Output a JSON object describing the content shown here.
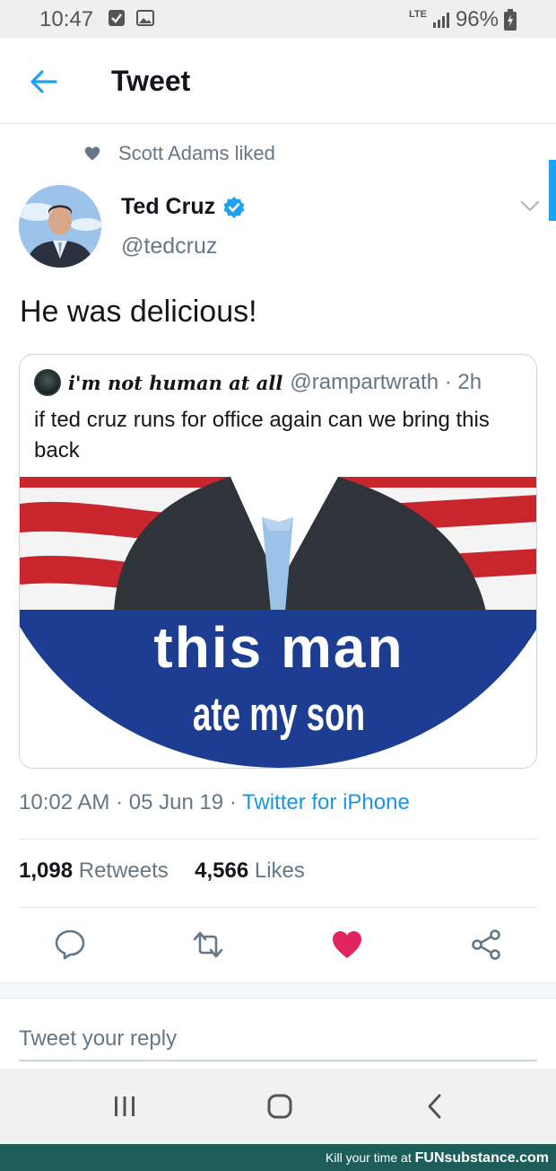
{
  "status_bar": {
    "time": "10:47",
    "network": "LTE",
    "battery": "96%"
  },
  "header": {
    "title": "Tweet"
  },
  "liked_by": {
    "text": "Scott Adams liked"
  },
  "tweet": {
    "author_name": "Ted Cruz",
    "author_handle": "@tedcruz",
    "text": "He was delicious!",
    "timestamp": "10:02 AM · 05 Jun 19 · ",
    "source": "Twitter for iPhone"
  },
  "quote": {
    "name": "i'm not human at all",
    "handle": "@rampartwrath · 2h",
    "text": "if ted cruz runs for office again can we bring this back",
    "image_line1": "this man",
    "image_line2": "ate my son"
  },
  "stats": {
    "retweets_count": "1,098",
    "retweets_label": "Retweets",
    "likes_count": "4,566",
    "likes_label": "Likes"
  },
  "reply": {
    "placeholder": "Tweet your reply"
  },
  "watermark": {
    "prefix": "Kill your time at ",
    "brand": "FUNsubstance.com"
  },
  "colors": {
    "twitter_blue": "#1da1f2",
    "like_red": "#e0245e",
    "muted": "#657786"
  }
}
